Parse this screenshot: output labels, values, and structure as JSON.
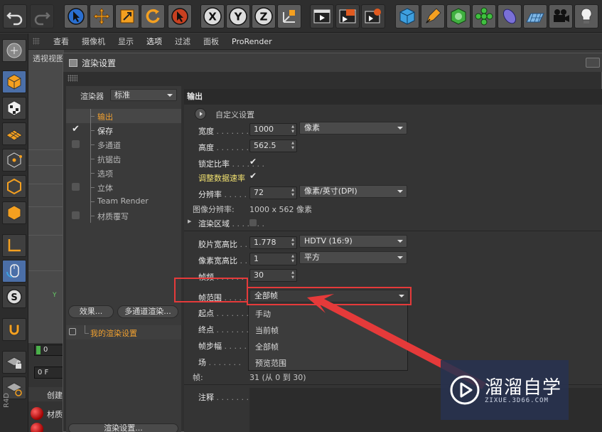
{
  "toolbar": {
    "icons": [
      "undo-icon",
      "redo-icon",
      "select-icon",
      "move-icon",
      "scale-icon",
      "rotate-icon",
      "live-select-icon",
      "x-axis-icon",
      "y-axis-icon",
      "z-axis-icon",
      "coordinate-icon",
      "render-view-icon",
      "render-picture-icon",
      "render-settings-icon",
      "cube-icon",
      "pen-icon",
      "subdivision-icon",
      "cloner-icon",
      "deformer-icon",
      "floor-icon",
      "camera-icon",
      "light-icon"
    ],
    "axes": [
      "X",
      "Y",
      "Z"
    ]
  },
  "menubar": {
    "items": [
      "查看",
      "摄像机",
      "显示",
      "选项",
      "过滤",
      "面板",
      "ProRender"
    ]
  },
  "viewport": {
    "label": "透视视图"
  },
  "dialog": {
    "title": "渲染设置",
    "renderer_label": "渲染器",
    "renderer_value": "标准",
    "items": [
      {
        "label": "输出",
        "checked": null
      },
      {
        "label": "保存",
        "checked": true
      },
      {
        "label": "多通道",
        "checked": false
      },
      {
        "label": "抗锯齿",
        "checked": null
      },
      {
        "label": "选项",
        "checked": null
      },
      {
        "label": "立体",
        "checked": false
      },
      {
        "label": "Team Render",
        "checked": null
      },
      {
        "label": "材质覆写",
        "checked": false
      }
    ],
    "effects_button": "效果...",
    "multipass_button": "多通道渲染...",
    "preset_label": "我的渲染设置",
    "render_settings_button": "渲染设置..."
  },
  "output": {
    "header": "输出",
    "preset_label": "自定义设置",
    "width_label": "宽度",
    "width_value": "1000",
    "unit_value": "像素",
    "height_label": "高度",
    "height_value": "562.5",
    "lock_ratio_label": "锁定比率",
    "adjust_rate_label": "调整数据速率",
    "resolution_label": "分辨率",
    "resolution_value": "72",
    "resolution_unit": "像素/英寸(DPI)",
    "image_res_label": "图像分辨率:",
    "image_res_value": "1000 x 562 像素",
    "render_region_label": "渲染区域",
    "film_aspect_label": "胶片宽高比",
    "film_aspect_value": "1.778",
    "film_aspect_preset": "HDTV (16:9)",
    "pixel_aspect_label": "像素宽高比",
    "pixel_aspect_value": "1",
    "pixel_aspect_preset": "平方",
    "fps_label": "帧频",
    "fps_value": "30",
    "frame_range_label": "帧范围",
    "frame_range_value": "全部帧",
    "start_label": "起点",
    "end_label": "终点",
    "step_label": "帧步幅",
    "field_label": "场",
    "frames_label": "帧:",
    "frames_value": "31 (从 0 到 30)",
    "notes_label": "注释"
  },
  "frame_range_options": [
    "手动",
    "当前帧",
    "全部帧",
    "预览范围"
  ],
  "timeline": {
    "frame_value": "0",
    "frame_field": "0 F",
    "create_label": "创建",
    "material_label": "材质"
  },
  "watermark": {
    "title": "溜溜自学",
    "subtitle": "ZIXUE.3D66.COM"
  }
}
